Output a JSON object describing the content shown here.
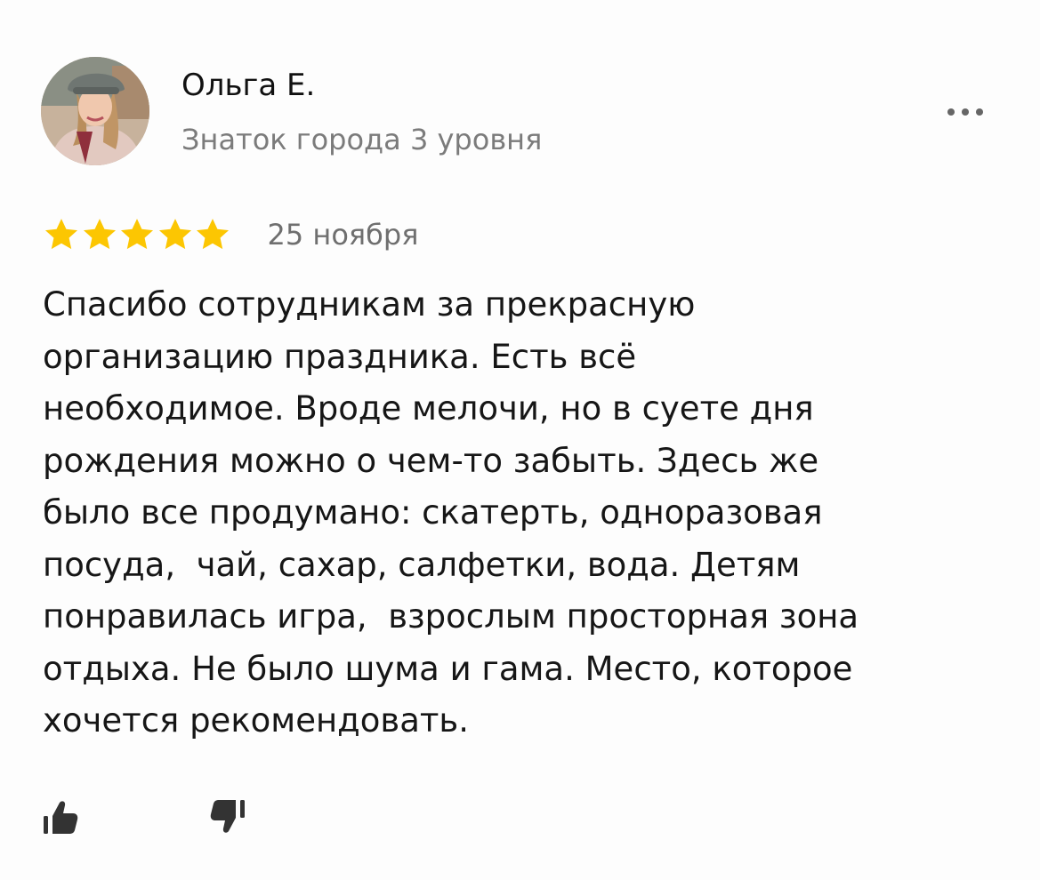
{
  "author": {
    "name": "Ольга Е.",
    "level": "Знаток города 3 уровня",
    "avatar": "user-photo"
  },
  "menu": {
    "icon": "more-dots-icon"
  },
  "rating": {
    "stars": 5,
    "max_stars": 5,
    "color": "#fcc602",
    "date": "25 ноября"
  },
  "review": {
    "lines": [
      "Спасибо сотрудникам за прекрасную",
      "организацию праздника. Есть всё",
      "необходимое. Вроде мелочи, но в суете дня",
      "рождения можно о чем-то забыть. Здесь же",
      "было все продумано: скатерть, одноразовая",
      "посуда,  чай, сахар, салфетки, вода. Детям",
      "понравилась игра,  взрослым просторная зона",
      "отдыха. Не было шума и гама. Место, которое",
      "хочется рекомендовать."
    ]
  },
  "reactions": {
    "like_icon": "thumbs-up-icon",
    "dislike_icon": "thumbs-down-icon"
  }
}
